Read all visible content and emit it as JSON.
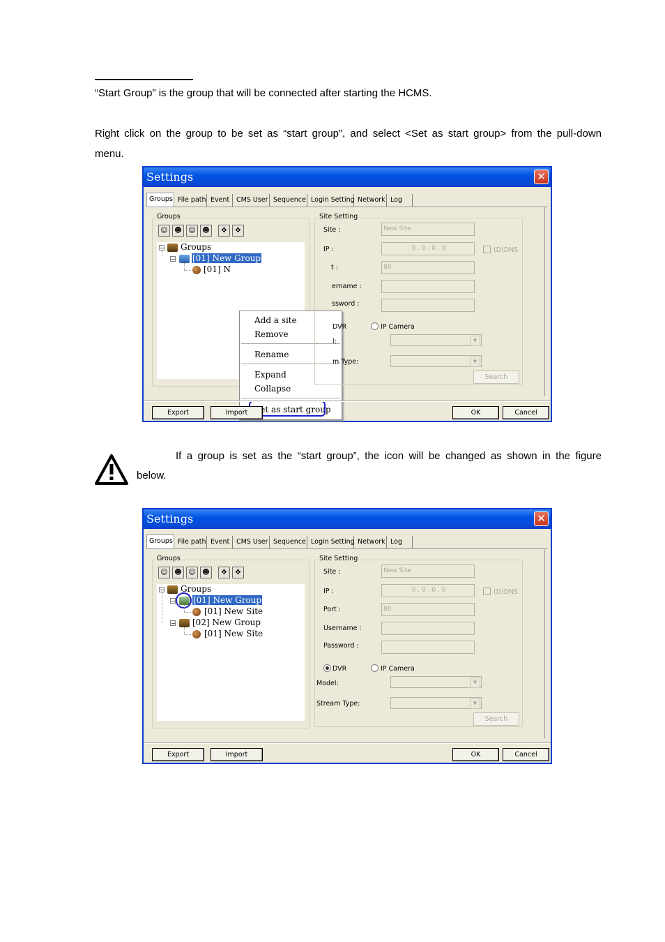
{
  "doc": {
    "intro": "“Start Group” is the group that will be connected after starting the HCMS.",
    "instruction_line1": "Right click on the group to be set as “start group”, and select <Set as start group> from the pull-down",
    "instruction_line2": "menu.",
    "note_line1": "If a group is set as the “start group”, the icon will be changed as shown in the figure",
    "note_line2": "below."
  },
  "window": {
    "title": "Settings",
    "close": "✕",
    "tabs": [
      "Groups",
      "File path",
      "Event",
      "CMS User",
      "Sequence",
      "Login Setting",
      "Network",
      "Log"
    ],
    "groups_label": "Groups",
    "site_setting_label": "Site Setting",
    "fields": {
      "site": "Site :",
      "site_value": "New Site",
      "ip": "IP :",
      "ip_value": "0  .  0  .  0  .  0",
      "ddns": "(D)DNS",
      "port": "Port :",
      "port_value": "80",
      "username": "Username :",
      "password": "Password :",
      "dvr": "DVR",
      "ip_camera": "IP Camera",
      "model": "Model:",
      "stream_type": "Stream Type:"
    },
    "search": "Search",
    "export": "Export",
    "import": "Import",
    "ok": "OK",
    "cancel": "Cancel"
  },
  "screenshot1": {
    "tree": {
      "root": "Groups",
      "group1": "[01] New Group",
      "site_partial": "[01] N"
    },
    "partial_labels": {
      "port": "t :",
      "username": "ername :",
      "password": "ssword :",
      "dvr": "DVR",
      "model": "l:",
      "stream_type": "m Type:"
    },
    "context_menu": [
      "Add a site",
      "Remove",
      "Rename",
      "Expand",
      "Collapse",
      "Set as start group"
    ]
  },
  "screenshot2": {
    "tree": {
      "root": "Groups",
      "group1": "[01] New Group",
      "group1_site": "[01] New Site",
      "group2": "[02] New Group",
      "group2_site": "[01] New Site"
    }
  }
}
